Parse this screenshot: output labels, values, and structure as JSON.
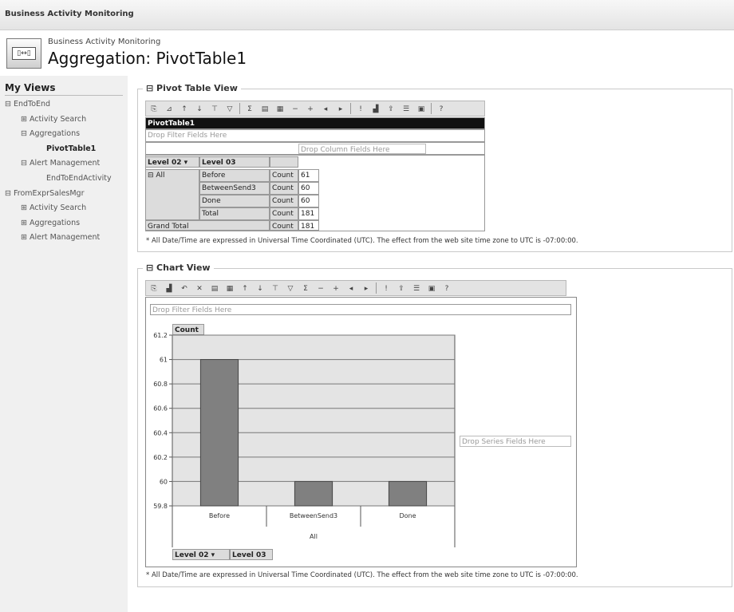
{
  "app": {
    "title": "Business Activity Monitoring"
  },
  "header": {
    "subtitle": "Business Activity Monitoring",
    "title": "Aggregation: PivotTable1"
  },
  "sidebar": {
    "heading": "My Views",
    "items": [
      {
        "label": "⊟ EndToEnd",
        "indent": 0,
        "bold": false
      },
      {
        "label": "⊞ Activity Search",
        "indent": 1,
        "bold": false
      },
      {
        "label": "⊟ Aggregations",
        "indent": 1,
        "bold": false
      },
      {
        "label": "PivotTable1",
        "indent": 2,
        "bold": true
      },
      {
        "label": "⊟ Alert Management",
        "indent": 1,
        "bold": false
      },
      {
        "label": "EndToEndActivity",
        "indent": 2,
        "bold": false
      },
      {
        "label": "⊟ FromExprSalesMgr",
        "indent": 0,
        "bold": false
      },
      {
        "label": "⊞ Activity Search",
        "indent": 1,
        "bold": false
      },
      {
        "label": "⊞ Aggregations",
        "indent": 1,
        "bold": false
      },
      {
        "label": "⊞ Alert Management",
        "indent": 1,
        "bold": false
      }
    ]
  },
  "pivot": {
    "legend": "⊟ Pivot Table View",
    "name": "PivotTable1",
    "drop_filter": "Drop Filter Fields Here",
    "drop_column": "Drop Column Fields Here",
    "level2": "Level 02 ▾",
    "level3": "Level 03",
    "all": "⊟ All",
    "rows": [
      {
        "label": "Before",
        "measure": "Count",
        "value": "61"
      },
      {
        "label": "BetweenSend3",
        "measure": "Count",
        "value": "60"
      },
      {
        "label": "Done",
        "measure": "Count",
        "value": "60"
      },
      {
        "label": "Total",
        "measure": "Count",
        "value": "181"
      }
    ],
    "grand_total": {
      "label": "Grand Total",
      "measure": "Count",
      "value": "181"
    },
    "footnote": "* All Date/Time are expressed in Universal Time Coordinated (UTC). The effect from the web site time zone to UTC is -07:00:00."
  },
  "chart": {
    "legend": "⊟ Chart View",
    "drop_filter": "Drop Filter Fields Here",
    "measure_button": "Count",
    "drop_series": "Drop Series Fields Here",
    "level2": "Level 02 ▾",
    "level3": "Level 03",
    "footnote": "* All Date/Time are expressed in Universal Time Coordinated (UTC). The effect from the web site time zone to UTC is -07:00:00."
  },
  "chart_data": {
    "type": "bar",
    "categories": [
      "Before",
      "BetweenSend3",
      "Done"
    ],
    "group_label": "All",
    "values": [
      61,
      60,
      60
    ],
    "ylim": [
      59.8,
      61.2
    ],
    "yticks": [
      "61.2",
      "61",
      "60.8",
      "60.6",
      "60.4",
      "60.2",
      "60",
      "59.8"
    ],
    "grid": true,
    "bar_color": "#808080"
  }
}
